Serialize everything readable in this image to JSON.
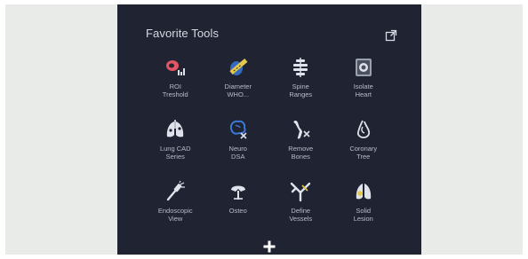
{
  "panel": {
    "title": "Favorite Tools",
    "popout_icon": "popout-icon",
    "add_icon": "plus-icon"
  },
  "tools": [
    {
      "label": "ROI\nTreshold",
      "icon": "roi-threshold-icon"
    },
    {
      "label": "Diameter\nWHO...",
      "icon": "diameter-ruler-icon"
    },
    {
      "label": "Spine\nRanges",
      "icon": "spine-icon"
    },
    {
      "label": "Isolate\nHeart",
      "icon": "heart-icon"
    },
    {
      "label": "Lung CAD\nSeries",
      "icon": "lungs-icon"
    },
    {
      "label": "Neuro\nDSA",
      "icon": "brain-icon"
    },
    {
      "label": "Remove\nBones",
      "icon": "bone-remove-icon"
    },
    {
      "label": "Coronary\nTree",
      "icon": "coronary-tree-icon"
    },
    {
      "label": "Endoscopic\nView",
      "icon": "endoscope-icon"
    },
    {
      "label": "Osteo",
      "icon": "osteo-icon"
    },
    {
      "label": "Define\nVessels",
      "icon": "vessels-icon"
    },
    {
      "label": "Solid\nLesion",
      "icon": "lesion-icon"
    }
  ],
  "colors": {
    "panel_bg": "#1f2332",
    "backdrop": "#e9ebe9",
    "accent_red": "#e25563",
    "accent_yellow": "#e4c84a",
    "accent_blue": "#3a78d8",
    "icon_white": "#dfe2ea"
  }
}
